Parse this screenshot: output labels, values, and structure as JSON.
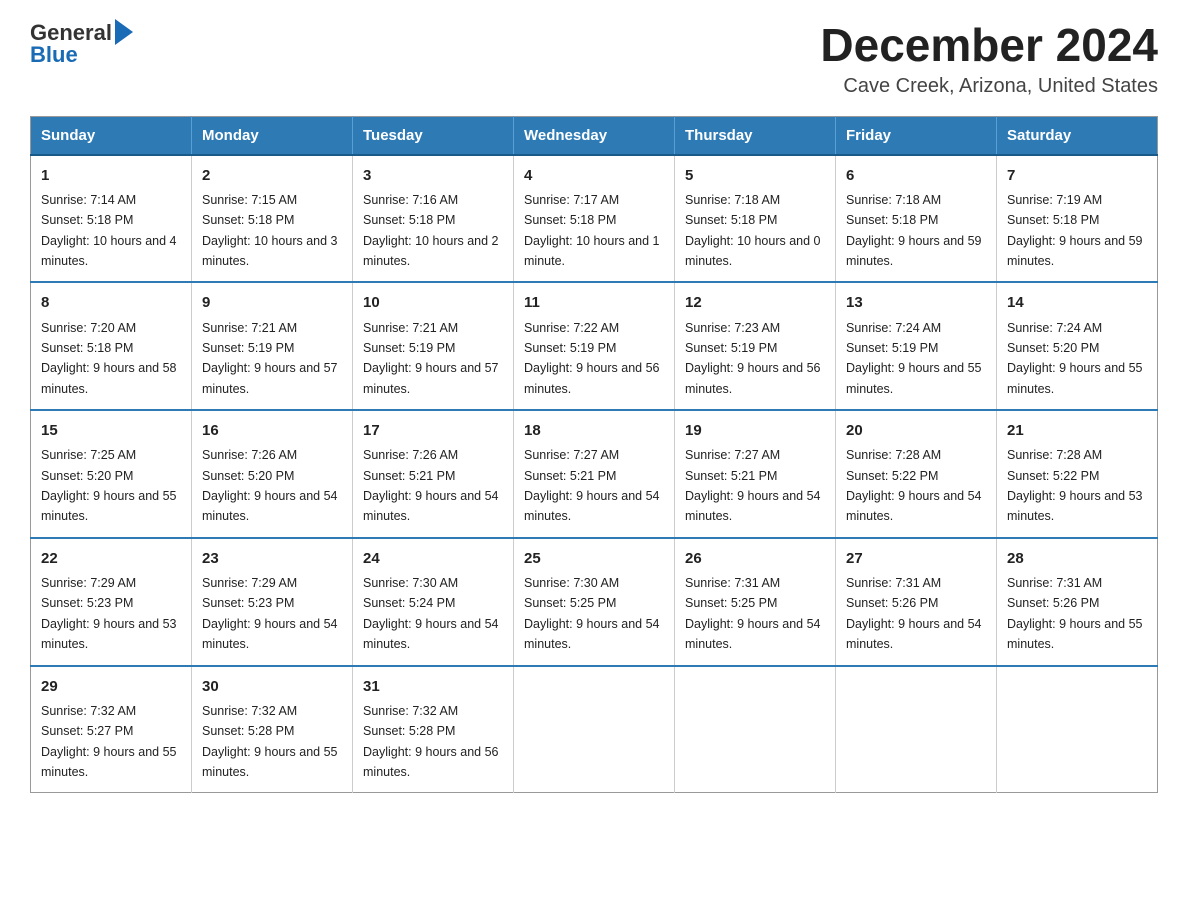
{
  "header": {
    "logo": {
      "general": "General",
      "blue": "Blue"
    },
    "title": "December 2024",
    "subtitle": "Cave Creek, Arizona, United States"
  },
  "weekdays": [
    "Sunday",
    "Monday",
    "Tuesday",
    "Wednesday",
    "Thursday",
    "Friday",
    "Saturday"
  ],
  "weeks": [
    [
      {
        "day": "1",
        "sunrise": "7:14 AM",
        "sunset": "5:18 PM",
        "daylight": "10 hours and 4 minutes."
      },
      {
        "day": "2",
        "sunrise": "7:15 AM",
        "sunset": "5:18 PM",
        "daylight": "10 hours and 3 minutes."
      },
      {
        "day": "3",
        "sunrise": "7:16 AM",
        "sunset": "5:18 PM",
        "daylight": "10 hours and 2 minutes."
      },
      {
        "day": "4",
        "sunrise": "7:17 AM",
        "sunset": "5:18 PM",
        "daylight": "10 hours and 1 minute."
      },
      {
        "day": "5",
        "sunrise": "7:18 AM",
        "sunset": "5:18 PM",
        "daylight": "10 hours and 0 minutes."
      },
      {
        "day": "6",
        "sunrise": "7:18 AM",
        "sunset": "5:18 PM",
        "daylight": "9 hours and 59 minutes."
      },
      {
        "day": "7",
        "sunrise": "7:19 AM",
        "sunset": "5:18 PM",
        "daylight": "9 hours and 59 minutes."
      }
    ],
    [
      {
        "day": "8",
        "sunrise": "7:20 AM",
        "sunset": "5:18 PM",
        "daylight": "9 hours and 58 minutes."
      },
      {
        "day": "9",
        "sunrise": "7:21 AM",
        "sunset": "5:19 PM",
        "daylight": "9 hours and 57 minutes."
      },
      {
        "day": "10",
        "sunrise": "7:21 AM",
        "sunset": "5:19 PM",
        "daylight": "9 hours and 57 minutes."
      },
      {
        "day": "11",
        "sunrise": "7:22 AM",
        "sunset": "5:19 PM",
        "daylight": "9 hours and 56 minutes."
      },
      {
        "day": "12",
        "sunrise": "7:23 AM",
        "sunset": "5:19 PM",
        "daylight": "9 hours and 56 minutes."
      },
      {
        "day": "13",
        "sunrise": "7:24 AM",
        "sunset": "5:19 PM",
        "daylight": "9 hours and 55 minutes."
      },
      {
        "day": "14",
        "sunrise": "7:24 AM",
        "sunset": "5:20 PM",
        "daylight": "9 hours and 55 minutes."
      }
    ],
    [
      {
        "day": "15",
        "sunrise": "7:25 AM",
        "sunset": "5:20 PM",
        "daylight": "9 hours and 55 minutes."
      },
      {
        "day": "16",
        "sunrise": "7:26 AM",
        "sunset": "5:20 PM",
        "daylight": "9 hours and 54 minutes."
      },
      {
        "day": "17",
        "sunrise": "7:26 AM",
        "sunset": "5:21 PM",
        "daylight": "9 hours and 54 minutes."
      },
      {
        "day": "18",
        "sunrise": "7:27 AM",
        "sunset": "5:21 PM",
        "daylight": "9 hours and 54 minutes."
      },
      {
        "day": "19",
        "sunrise": "7:27 AM",
        "sunset": "5:21 PM",
        "daylight": "9 hours and 54 minutes."
      },
      {
        "day": "20",
        "sunrise": "7:28 AM",
        "sunset": "5:22 PM",
        "daylight": "9 hours and 54 minutes."
      },
      {
        "day": "21",
        "sunrise": "7:28 AM",
        "sunset": "5:22 PM",
        "daylight": "9 hours and 53 minutes."
      }
    ],
    [
      {
        "day": "22",
        "sunrise": "7:29 AM",
        "sunset": "5:23 PM",
        "daylight": "9 hours and 53 minutes."
      },
      {
        "day": "23",
        "sunrise": "7:29 AM",
        "sunset": "5:23 PM",
        "daylight": "9 hours and 54 minutes."
      },
      {
        "day": "24",
        "sunrise": "7:30 AM",
        "sunset": "5:24 PM",
        "daylight": "9 hours and 54 minutes."
      },
      {
        "day": "25",
        "sunrise": "7:30 AM",
        "sunset": "5:25 PM",
        "daylight": "9 hours and 54 minutes."
      },
      {
        "day": "26",
        "sunrise": "7:31 AM",
        "sunset": "5:25 PM",
        "daylight": "9 hours and 54 minutes."
      },
      {
        "day": "27",
        "sunrise": "7:31 AM",
        "sunset": "5:26 PM",
        "daylight": "9 hours and 54 minutes."
      },
      {
        "day": "28",
        "sunrise": "7:31 AM",
        "sunset": "5:26 PM",
        "daylight": "9 hours and 55 minutes."
      }
    ],
    [
      {
        "day": "29",
        "sunrise": "7:32 AM",
        "sunset": "5:27 PM",
        "daylight": "9 hours and 55 minutes."
      },
      {
        "day": "30",
        "sunrise": "7:32 AM",
        "sunset": "5:28 PM",
        "daylight": "9 hours and 55 minutes."
      },
      {
        "day": "31",
        "sunrise": "7:32 AM",
        "sunset": "5:28 PM",
        "daylight": "9 hours and 56 minutes."
      },
      null,
      null,
      null,
      null
    ]
  ],
  "labels": {
    "sunrise": "Sunrise:",
    "sunset": "Sunset:",
    "daylight": "Daylight:"
  }
}
